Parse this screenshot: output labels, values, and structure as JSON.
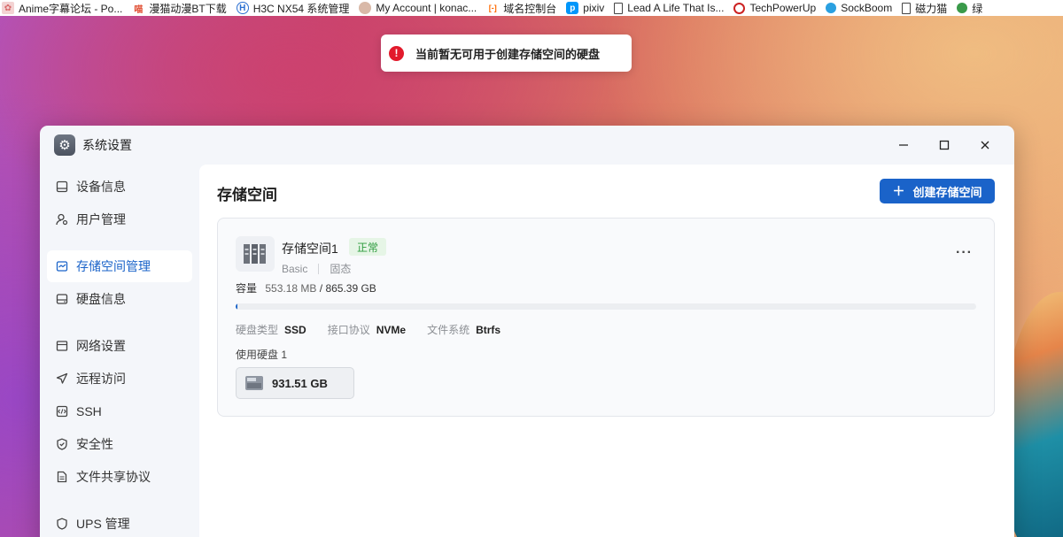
{
  "bookmarks": [
    {
      "label": "Anime字幕论坛 - Po...",
      "icon": "anime-forum-icon",
      "color": "#d86a6a"
    },
    {
      "label": "漫猫动漫BT下载",
      "icon": "manmao-icon",
      "color": "#e04b2f",
      "glyph": "喵"
    },
    {
      "label": "H3C NX54 系统管理",
      "icon": "h3c-icon",
      "color": "#2a6fd1",
      "glyph": "H"
    },
    {
      "label": "My Account | konac...",
      "icon": "konachan-icon",
      "color": "#b07a64"
    },
    {
      "label": "域名控制台",
      "icon": "aliyun-icon",
      "color": "#ff6a00",
      "glyph": "[-]"
    },
    {
      "label": "pixiv",
      "icon": "pixiv-icon",
      "color": "#0096fa",
      "glyph": "p"
    },
    {
      "label": "Lead A Life That Is...",
      "icon": "page-icon",
      "color": "#444444"
    },
    {
      "label": "TechPowerUp",
      "icon": "techpowerup-icon",
      "color": "#cc2222"
    },
    {
      "label": "SockBoom",
      "icon": "sockboom-icon",
      "color": "#2aa0e0"
    },
    {
      "label": "磁力猫",
      "icon": "page-icon",
      "color": "#444444"
    },
    {
      "label": "绿",
      "icon": "green-icon",
      "color": "#3a9a4a"
    }
  ],
  "toast": {
    "message": "当前暂无可用于创建存储空间的硬盘",
    "icon": "error-icon",
    "color": "#e21a2c"
  },
  "window": {
    "title": "系统设置",
    "icon": "settings-gear-icon"
  },
  "sidebar": {
    "items": [
      {
        "label": "设备信息",
        "icon": "device-icon",
        "active": false
      },
      {
        "label": "用户管理",
        "icon": "user-icon",
        "active": false
      },
      {
        "label": "存储空间管理",
        "icon": "storage-icon",
        "active": true
      },
      {
        "label": "硬盘信息",
        "icon": "disk-icon",
        "active": false
      },
      {
        "label": "网络设置",
        "icon": "network-icon",
        "active": false
      },
      {
        "label": "远程访问",
        "icon": "remote-icon",
        "active": false
      },
      {
        "label": "SSH",
        "icon": "ssh-icon",
        "active": false
      },
      {
        "label": "安全性",
        "icon": "shield-icon",
        "active": false
      },
      {
        "label": "文件共享协议",
        "icon": "file-share-icon",
        "active": false
      },
      {
        "label": "UPS 管理",
        "icon": "ups-icon",
        "active": false
      }
    ]
  },
  "main": {
    "title": "存储空间",
    "create_button": "创建存储空间",
    "pool": {
      "name": "存储空间1",
      "status": "正常",
      "raid": "Basic",
      "media": "固态",
      "capacity_label": "容量",
      "used": "553.18 MB",
      "slash": "/",
      "total": "865.39 GB",
      "usage_fraction": 0.0006,
      "specs": [
        {
          "key": "硬盘类型",
          "value": "SSD"
        },
        {
          "key": "接口协议",
          "value": "NVMe"
        },
        {
          "key": "文件系统",
          "value": "Btrfs"
        }
      ],
      "used_disks_label": "使用硬盘 1",
      "disk_size": "931.51 GB"
    }
  },
  "colors": {
    "accent": "#1a63c9",
    "status_ok": "#2e9c3e",
    "error": "#e21a2c"
  }
}
